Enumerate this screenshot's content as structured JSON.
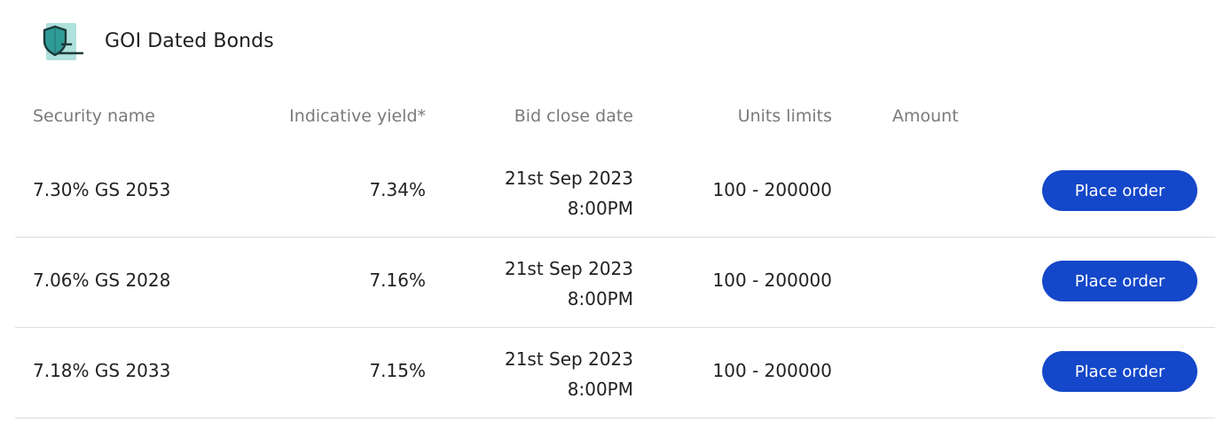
{
  "header": {
    "icon": "shield-card-icon",
    "title": "GOI Dated Bonds",
    "colors": {
      "icon_bg": "#aee0dc",
      "icon_shield": "#2f9b96",
      "icon_dark": "#1c3a3a"
    }
  },
  "table": {
    "columns": {
      "security_name": "Security name",
      "indicative_yield": "Indicative yield*",
      "bid_close_date": "Bid close date",
      "units_limits": "Units limits",
      "amount": "Amount"
    },
    "rows": [
      {
        "security_name": "7.30% GS 2053",
        "indicative_yield": "7.34%",
        "bid_close_date": "21st Sep 2023",
        "bid_close_time": "8:00PM",
        "units_limits": "100 - 200000",
        "action_label": "Place order"
      },
      {
        "security_name": "7.06% GS 2028",
        "indicative_yield": "7.16%",
        "bid_close_date": "21st Sep 2023",
        "bid_close_time": "8:00PM",
        "units_limits": "100 - 200000",
        "action_label": "Place order"
      },
      {
        "security_name": "7.18% GS 2033",
        "indicative_yield": "7.15%",
        "bid_close_date": "21st Sep 2023",
        "bid_close_time": "8:00PM",
        "units_limits": "100 - 200000",
        "action_label": "Place order"
      }
    ]
  },
  "colors": {
    "accent": "#1447c9",
    "header_text": "#7a7a7a",
    "divider": "#dcdcdc"
  }
}
